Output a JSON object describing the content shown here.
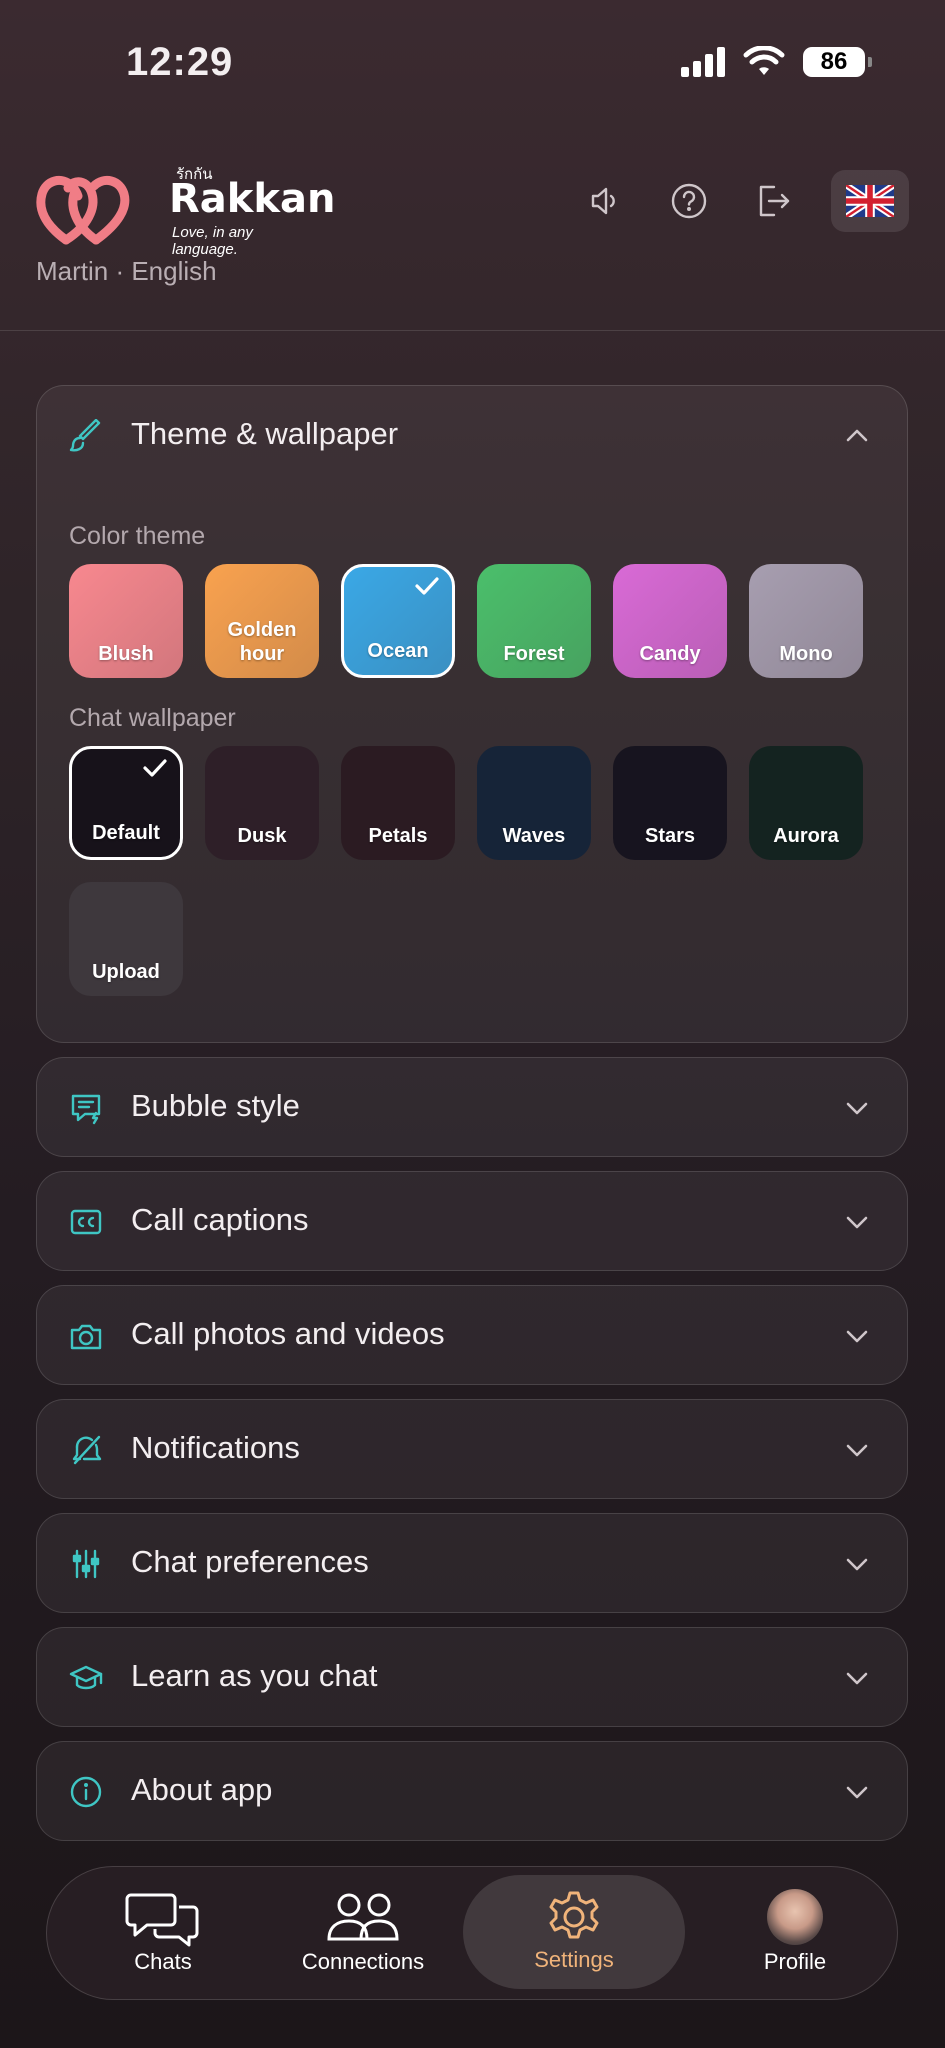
{
  "status_bar": {
    "time": "12:29",
    "battery": "86"
  },
  "brand": {
    "thai": "รักกัน",
    "name": "Rakkan",
    "tagline": "Love, in any language."
  },
  "user_line": "Martin · English",
  "header_actions": [
    "speaker-icon",
    "help-icon",
    "logout-icon",
    "uk-flag-icon"
  ],
  "theme_panel": {
    "title": "Theme & wallpaper",
    "color_theme_label": "Color theme",
    "color_themes": [
      {
        "label": "Blush",
        "color": "#f8888f",
        "selected": false
      },
      {
        "label": "Golden hour",
        "color": "#f9a24f",
        "selected": false
      },
      {
        "label": "Ocean",
        "color": "#3aa8e6",
        "selected": true
      },
      {
        "label": "Forest",
        "color": "#4bbf6b",
        "selected": false
      },
      {
        "label": "Candy",
        "color": "#d96ad6",
        "selected": false
      },
      {
        "label": "Mono",
        "color": "#a79eb0",
        "selected": false
      }
    ],
    "chat_wallpaper_label": "Chat wallpaper",
    "wallpapers": [
      {
        "label": "Default",
        "color": "#17121a",
        "selected": true
      },
      {
        "label": "Dusk",
        "color": "#2e1f28",
        "selected": false
      },
      {
        "label": "Petals",
        "color": "#2b1b22",
        "selected": false
      },
      {
        "label": "Waves",
        "color": "#162438",
        "selected": false
      },
      {
        "label": "Stars",
        "color": "#17141f",
        "selected": false
      },
      {
        "label": "Aurora",
        "color": "#142320",
        "selected": false
      },
      {
        "label": "Upload",
        "color": "#3e383d",
        "selected": false
      }
    ]
  },
  "sections": [
    {
      "title": "Bubble style",
      "icon": "message-icon"
    },
    {
      "title": "Call captions",
      "icon": "captions-icon"
    },
    {
      "title": "Call photos and videos",
      "icon": "camera-icon"
    },
    {
      "title": "Notifications",
      "icon": "bell-off-icon"
    },
    {
      "title": "Chat preferences",
      "icon": "sliders-icon"
    },
    {
      "title": "Learn as you chat",
      "icon": "graduation-cap-icon"
    },
    {
      "title": "About app",
      "icon": "info-icon"
    }
  ],
  "tabs": [
    {
      "label": "Chats",
      "icon": "chats-icon"
    },
    {
      "label": "Connections",
      "icon": "connections-icon"
    },
    {
      "label": "Settings",
      "icon": "settings-icon",
      "active": true
    },
    {
      "label": "Profile",
      "icon": "avatar"
    }
  ],
  "colors": {
    "accent": "#3fc6c4",
    "active_tab": "#f0b37a"
  }
}
